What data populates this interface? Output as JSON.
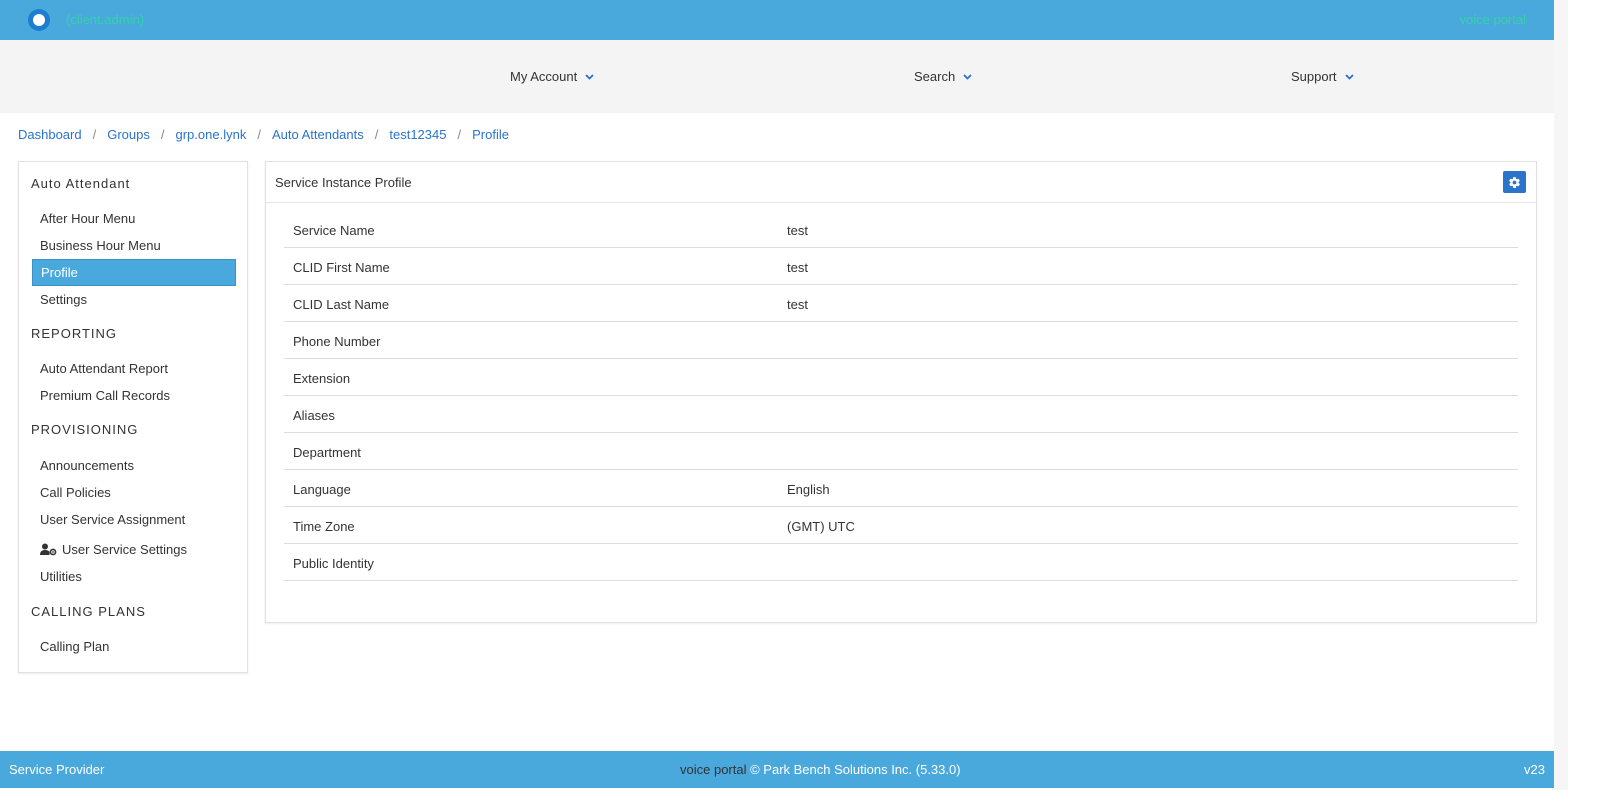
{
  "header": {
    "user_name": "(client.admin)",
    "portal_name": "voice portal"
  },
  "nav": {
    "items": [
      {
        "label": "My Account"
      },
      {
        "label": "Search"
      },
      {
        "label": "Support"
      }
    ]
  },
  "breadcrumb": {
    "items": [
      {
        "label": "Dashboard"
      },
      {
        "label": "Groups"
      },
      {
        "label": "grp.one.lynk"
      },
      {
        "label": "Auto Attendants"
      },
      {
        "label": "test12345"
      },
      {
        "label": "Profile"
      }
    ],
    "separator": "/"
  },
  "sidebar": {
    "sections": [
      {
        "heading": "Auto Attendant",
        "items": [
          {
            "label": "After Hour Menu"
          },
          {
            "label": "Business Hour Menu"
          },
          {
            "label": "Profile",
            "active": true
          },
          {
            "label": "Settings"
          }
        ]
      },
      {
        "heading": "REPORTING",
        "items": [
          {
            "label": "Auto Attendant Report"
          },
          {
            "label": "Premium Call Records"
          }
        ]
      },
      {
        "heading": "PROVISIONING",
        "items": [
          {
            "label": "Announcements"
          },
          {
            "label": "Call Policies"
          },
          {
            "label": "User Service Assignment"
          },
          {
            "label": "User Service Settings",
            "icon": "user-gear-icon"
          },
          {
            "label": "Utilities"
          }
        ]
      },
      {
        "heading": "CALLING PLANS",
        "items": [
          {
            "label": "Calling Plan"
          }
        ]
      }
    ]
  },
  "panel": {
    "title": "Service Instance Profile",
    "rows": [
      {
        "label": "Service Name",
        "value": "test"
      },
      {
        "label": "CLID First Name",
        "value": "test"
      },
      {
        "label": "CLID Last Name",
        "value": "test"
      },
      {
        "label": "Phone Number",
        "value": ""
      },
      {
        "label": "Extension",
        "value": ""
      },
      {
        "label": "Aliases",
        "value": ""
      },
      {
        "label": "Department",
        "value": ""
      },
      {
        "label": "Language",
        "value": "English"
      },
      {
        "label": "Time Zone",
        "value": "(GMT) UTC"
      },
      {
        "label": "Public Identity",
        "value": ""
      }
    ]
  },
  "footer": {
    "left": "Service Provider",
    "center_portal": "voice portal",
    "center_rest": " © Park Bench Solutions Inc. (5.33.0)",
    "right": "v23"
  },
  "colors": {
    "primary": "#4aa9dc",
    "accent_text": "#34d3a6",
    "link": "#2a74c9"
  }
}
